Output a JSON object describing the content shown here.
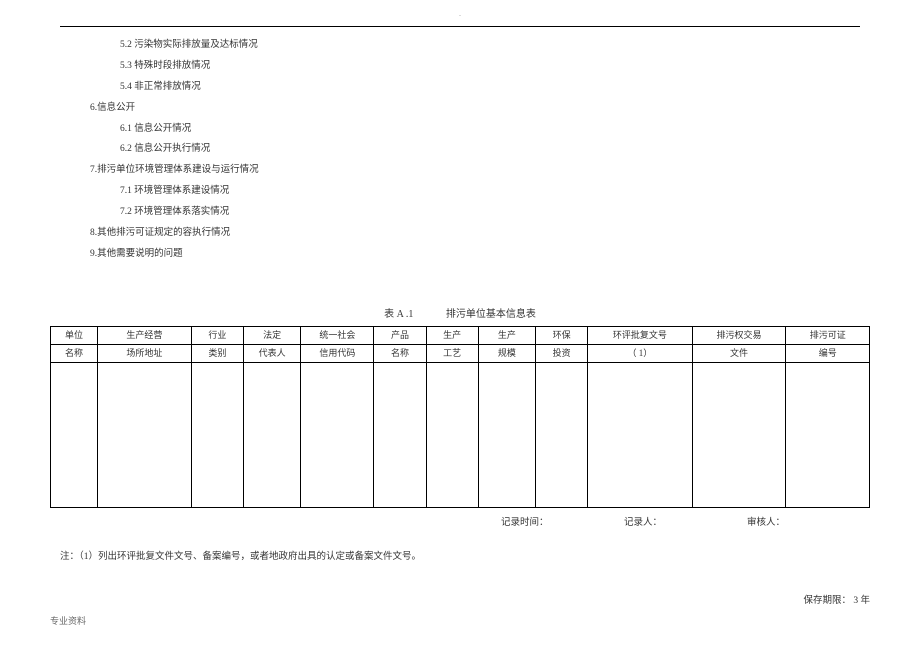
{
  "topDot": ".",
  "toc": {
    "i1": "5.2 污染物实际排放量及达标情况",
    "i2": "5.3 特殊时段排放情况",
    "i3": "5.4 非正常排放情况",
    "s6": "6.信息公开",
    "i4": "6.1 信息公开情况",
    "i5": "6.2 信息公开执行情况",
    "s7": "7.排污单位环境管理体系建设与运行情况",
    "i6": "7.1 环境管理体系建设情况",
    "i7": "7.2 环境管理体系落实情况",
    "s8": "8.其他排污可证规定的容执行情况",
    "s9": "9.其他需要说明的问题"
  },
  "tableTitle": {
    "label": "表 A .1",
    "name": "排污单位基本信息表"
  },
  "headers": {
    "c1a": "单位",
    "c1b": "名称",
    "c2a": "生产经营",
    "c2b": "场所地址",
    "c3a": "行业",
    "c3b": "类别",
    "c4a": "法定",
    "c4b": "代表人",
    "c5a": "统一社会",
    "c5b": "信用代码",
    "c6a": "产品",
    "c6b": "名称",
    "c7a": "生产",
    "c7b": "工艺",
    "c8a": "生产",
    "c8b": "规模",
    "c9a": "环保",
    "c9b": "投资",
    "c10a": "环评批复文号",
    "c10b": "（ 1）",
    "c11a": "排污权交易",
    "c11b": "文件",
    "c12a": "排污可证",
    "c12b": "编号"
  },
  "footerLine": {
    "recTime": "记录时间：",
    "recorder": "记录人：",
    "reviewer": "审核人："
  },
  "note": "注：（1）列出环评批复文件文号、备案编号，或者地政府出具的认定或备案文件文号。",
  "retain": "保存期限： 3 年",
  "docFooter": "专业资料"
}
